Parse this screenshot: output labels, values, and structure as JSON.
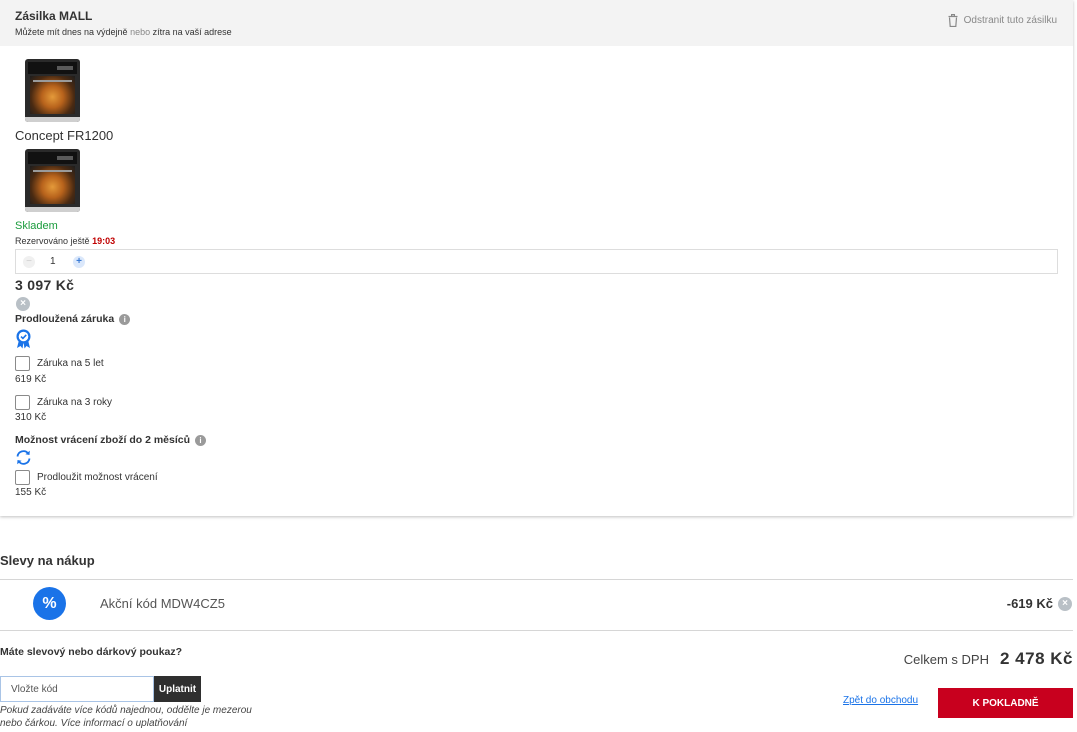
{
  "shipment": {
    "title": "Zásilka MALL",
    "subtitle_part1": "Můžete mít dnes na výdejně",
    "subtitle_or": "nebo",
    "subtitle_part2": "zítra na vaší adrese",
    "remove_label": "Odstranit tuto zásilku",
    "remove_icon": "trash-icon"
  },
  "product": {
    "name": "Concept FR1200",
    "stock": "Skladem",
    "reserved_label": "Rezervováno ještě",
    "reserved_time": "19:03",
    "quantity": "1",
    "minus_label": "−",
    "plus_label": "+",
    "price": "3 097 Kč",
    "remove_symbol": "×",
    "colors": {
      "stock": "#1a9b3c",
      "reserved_time": "#c00000"
    }
  },
  "warranty": {
    "title": "Prodloužená záruka",
    "info_symbol": "i",
    "icon": "rosette-badge-icon",
    "options": [
      {
        "label": "Záruka na 5 let",
        "price": "619 Kč",
        "checked": false
      },
      {
        "label": "Záruka na 3 roky",
        "price": "310 Kč",
        "checked": false
      }
    ]
  },
  "returns": {
    "title": "Možnost vrácení zboží do 2 měsíců",
    "info_symbol": "i",
    "icon": "refresh-icon",
    "option": {
      "label": "Prodloužit možnost vrácení",
      "price": "155 Kč",
      "checked": false
    }
  },
  "discounts": {
    "title": "Slevy na nákup",
    "percent_symbol": "%",
    "code_label": "Akční kód MDW4CZ5",
    "code_value": "-619 Kč",
    "remove_symbol": "×"
  },
  "voucher": {
    "question": "Máte slevový nebo dárkový poukaz?",
    "input_placeholder": "Vložte kód",
    "input_value": "",
    "apply_label": "Uplatnit",
    "hint": "Pokud zadáváte více kódů najednou, oddělte je mezerou nebo čárkou. Více informací o uplatňování"
  },
  "summary": {
    "total_label": "Celkem s DPH",
    "total_value": "2 478 Kč",
    "back_link": "Zpět do obchodu",
    "checkout_label": "K POKLADNĚ",
    "colors": {
      "accent": "#1a73e8",
      "checkout": "#c8001e"
    }
  }
}
